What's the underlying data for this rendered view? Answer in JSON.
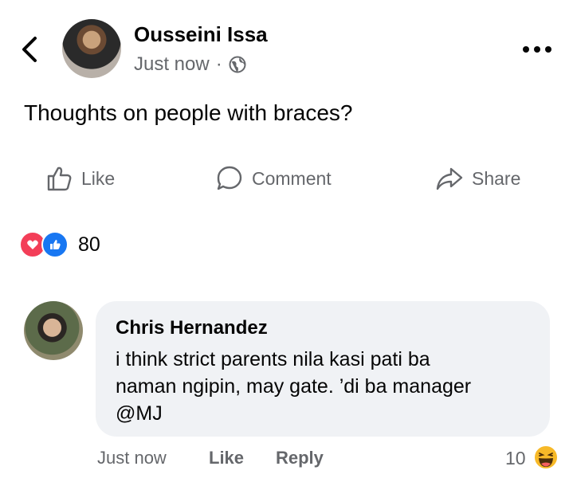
{
  "post": {
    "author": "Ousseini Issa",
    "timestamp": "Just now",
    "separator": "·",
    "text": "Thoughts on people with braces?",
    "actions": {
      "like": "Like",
      "comment": "Comment",
      "share": "Share"
    },
    "reaction_count": "80",
    "reactions": [
      "love-reaction-icon",
      "like-reaction-icon"
    ]
  },
  "comment": {
    "author": "Chris Hernandez",
    "lines": [
      "i think strict parents nila kasi pati ba",
      "naman ngipin, may gate. ’di ba manager",
      "@MJ"
    ],
    "timestamp": "Just now",
    "like_label": "Like",
    "reply_label": "Reply",
    "reaction_count": "10",
    "reaction_icon": "haha-emoji-icon"
  },
  "colors": {
    "like_blue": "#1877f2",
    "love_red": "#f33e58",
    "muted": "#65676b",
    "bubble_bg": "#f0f2f5",
    "haha_yellow": "#f7b928"
  }
}
